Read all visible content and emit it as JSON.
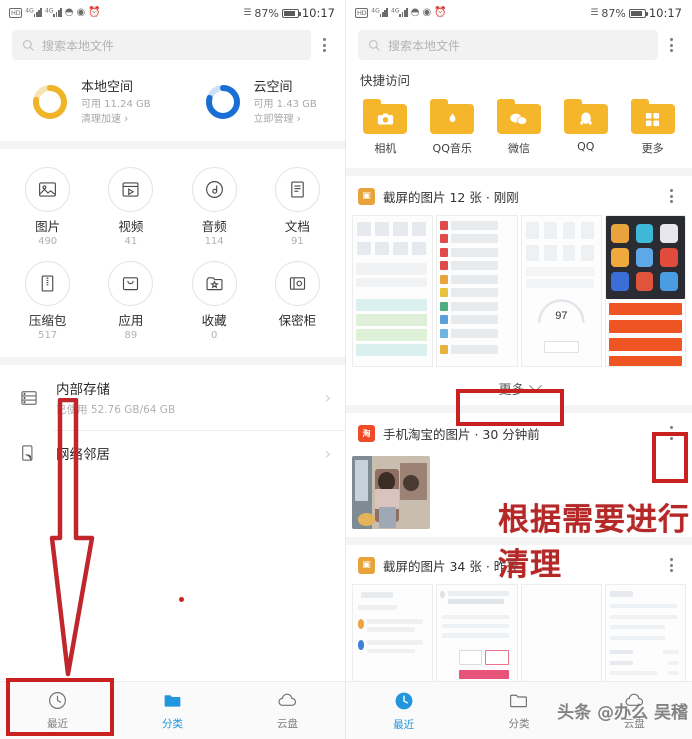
{
  "status_bar": {
    "hd_label": "HD",
    "network_label": "4G",
    "battery_percent": "87%",
    "time": "10:17"
  },
  "search": {
    "placeholder": "搜索本地文件",
    "menu_icon": "kebab-menu-icon",
    "search_icon": "search-icon"
  },
  "left_panel": {
    "storage_cards": [
      {
        "title": "本地空间",
        "subtitle": "可用 11.24 GB",
        "action": "清理加速",
        "color": "#f0b429",
        "track": "#f7e4b4",
        "percent": 78
      },
      {
        "title": "云空间",
        "subtitle": "可用 1.43 GB",
        "action": "立即管理",
        "color": "#1b6fd4",
        "track": "#cfe0f5",
        "percent": 80
      }
    ],
    "categories": [
      {
        "name": "图片",
        "count": "490",
        "icon": "image-icon"
      },
      {
        "name": "视频",
        "count": "41",
        "icon": "video-icon"
      },
      {
        "name": "音频",
        "count": "114",
        "icon": "audio-icon"
      },
      {
        "name": "文档",
        "count": "91",
        "icon": "document-icon"
      },
      {
        "name": "压缩包",
        "count": "517",
        "icon": "archive-icon"
      },
      {
        "name": "应用",
        "count": "89",
        "icon": "app-icon"
      },
      {
        "name": "收藏",
        "count": "0",
        "icon": "star-folder-icon"
      },
      {
        "name": "保密柜",
        "count": "",
        "icon": "safe-box-icon"
      }
    ],
    "storage_entries": [
      {
        "title": "内部存储",
        "subtitle": "已使用 52.76 GB/64 GB",
        "icon": "internal-storage-icon"
      },
      {
        "title": "网络邻居",
        "subtitle": "",
        "icon": "network-neighbor-icon"
      }
    ],
    "nav": [
      {
        "label": "最近",
        "icon": "clock-icon",
        "active": false
      },
      {
        "label": "分类",
        "icon": "folder-icon",
        "active": true
      },
      {
        "label": "云盘",
        "icon": "cloud-icon",
        "active": false
      }
    ]
  },
  "right_panel": {
    "section_title": "快捷访问",
    "quick_access": [
      {
        "label": "相机",
        "icon": "camera-folder-icon",
        "glyph": "◉"
      },
      {
        "label": "QQ音乐",
        "icon": "qqmusic-folder-icon",
        "glyph": "♪"
      },
      {
        "label": "微信",
        "icon": "wechat-folder-icon",
        "glyph": "●●"
      },
      {
        "label": "QQ",
        "icon": "qq-folder-icon",
        "glyph": "◑"
      },
      {
        "label": "更多",
        "icon": "more-folder-icon",
        "glyph": "⊞"
      }
    ],
    "groups": [
      {
        "title": "截屏的图片 12 张 · 刚刚",
        "app_icon": "screenshot-app-icon",
        "app_color": "#e8a33d",
        "app_glyph": "▣",
        "menu_icon": "kebab-menu-icon"
      },
      {
        "title": "手机淘宝的图片 · 30 分钟前",
        "app_icon": "taobao-app-icon",
        "app_color": "#f04a28",
        "app_glyph": "淘",
        "menu_icon": "kebab-menu-icon"
      },
      {
        "title": "截屏的图片 34 张 · 昨天",
        "app_icon": "screenshot-app-icon",
        "app_color": "#e8a33d",
        "app_glyph": "▣",
        "menu_icon": "kebab-menu-icon"
      }
    ],
    "more_button": "更多",
    "nav": [
      {
        "label": "最近",
        "icon": "clock-icon",
        "active": true
      },
      {
        "label": "分类",
        "icon": "folder-icon",
        "active": false
      },
      {
        "label": "云盘",
        "icon": "cloud-icon",
        "active": false
      }
    ]
  },
  "annotations": {
    "red_text": "根据需要进行清理",
    "watermark": "头条 @办么 吴稽"
  }
}
